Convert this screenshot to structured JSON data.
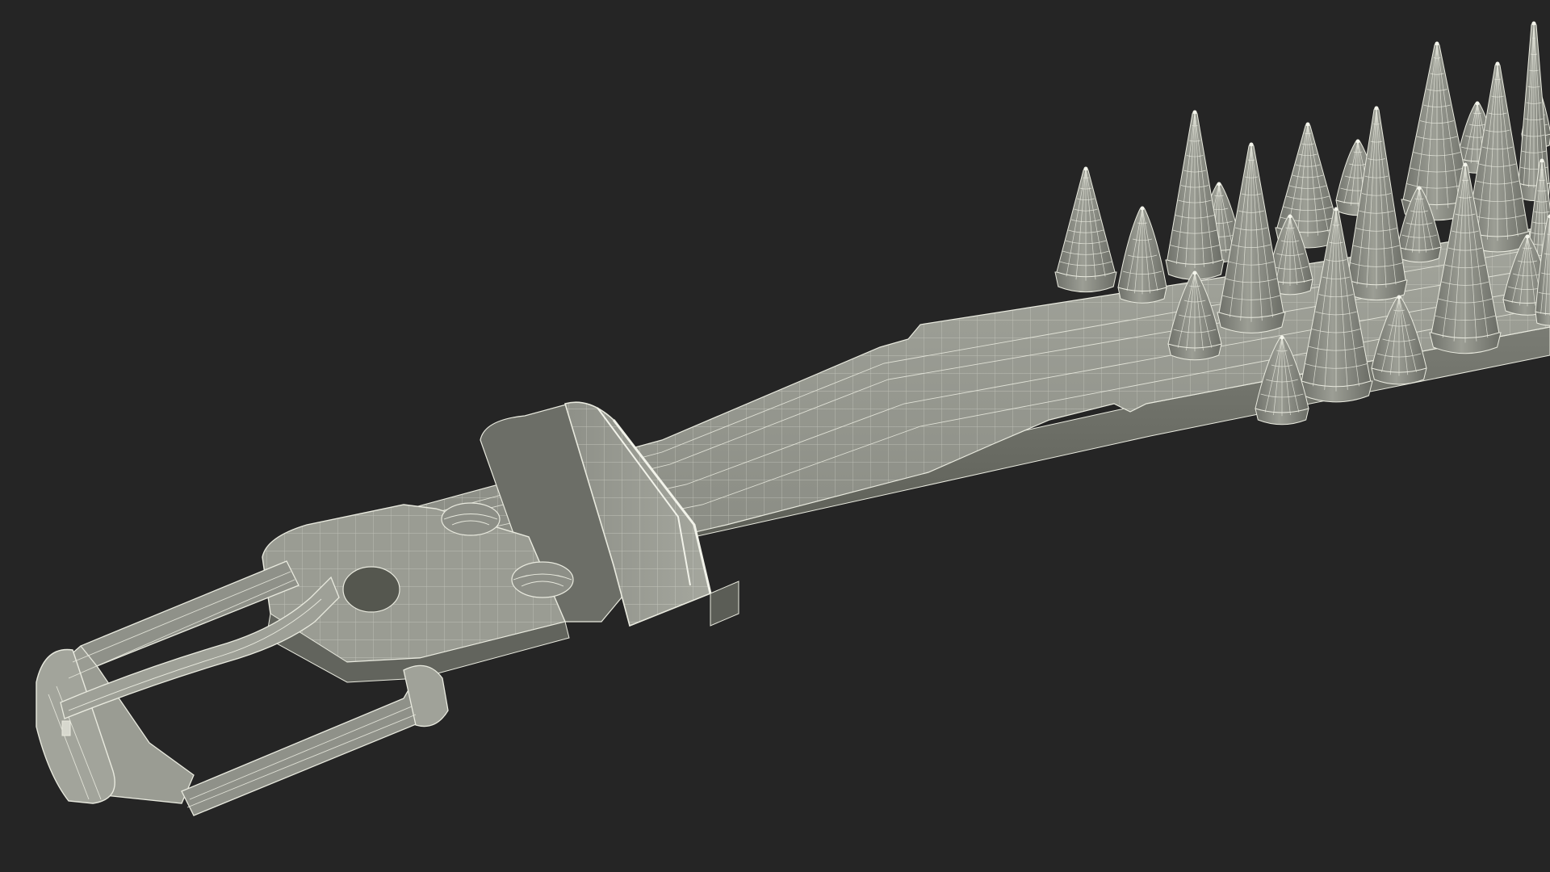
{
  "viewport": {
    "background_color": "#252525",
    "render_mode": "wireframe-on-shaded"
  },
  "model": {
    "surface_color": "#8c8e86",
    "surface_light_color": "#a9aba2",
    "surface_dark_color": "#5f615a",
    "wire_color": "#e9eadf",
    "parts": [
      "buckle-frame-icon",
      "buckle-prong-icon",
      "belt-strap-icon",
      "belt-loop-icon",
      "rivet-icon",
      "spike-icon"
    ],
    "spike_count_visible": 23
  }
}
